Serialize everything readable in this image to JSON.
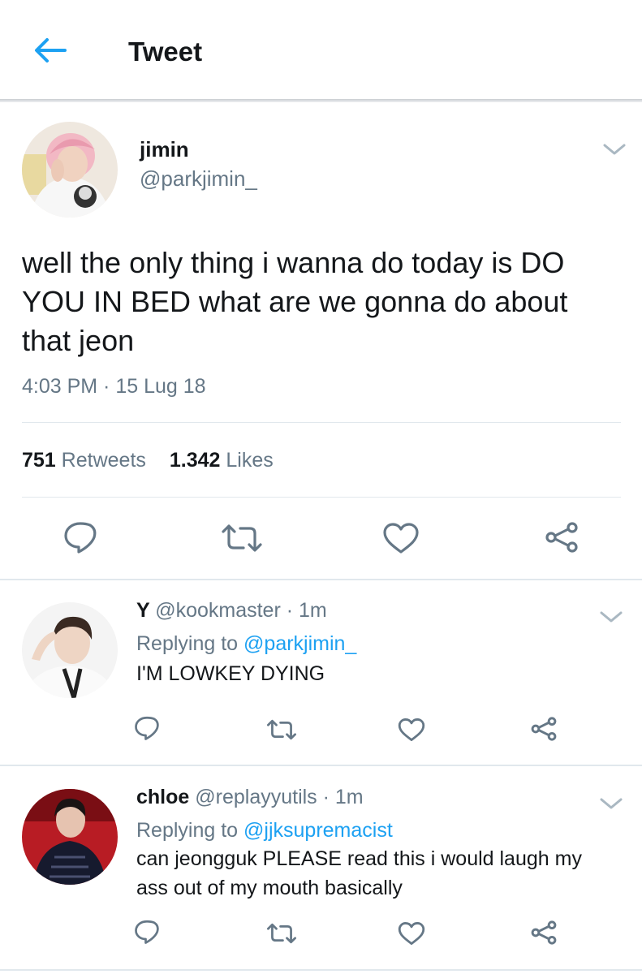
{
  "header": {
    "title": "Tweet"
  },
  "tweet": {
    "name": "jimin",
    "handle": "@parkjimin_",
    "text": "well the only thing i wanna do today is DO YOU IN BED what are we gonna do about that jeon",
    "timestamp": "4:03 PM · 15 Lug 18",
    "retweets": "751",
    "retweets_label": "Retweets",
    "likes": "1.342",
    "likes_label": "Likes"
  },
  "replies": [
    {
      "name": "Y",
      "meta": "@kookmaster · 1m",
      "replying_prefix": "Replying to",
      "replying_to": "@parkjimin_",
      "text": "I'M LOWKEY DYING"
    },
    {
      "name": "chloe",
      "meta": "@replayyutils · 1m",
      "replying_prefix": "Replying to",
      "replying_to": "@jjksupremacist",
      "text": "can jeongguk PLEASE read this i would laugh my ass out of my mouth basically"
    }
  ],
  "colors": {
    "accent": "#1da1f2",
    "muted": "#657786",
    "text": "#14171a",
    "divider": "#e1e8ed"
  },
  "icons": [
    "back-arrow-icon",
    "chevron-down-icon",
    "reply-icon",
    "retweet-icon",
    "like-icon",
    "share-icon"
  ]
}
